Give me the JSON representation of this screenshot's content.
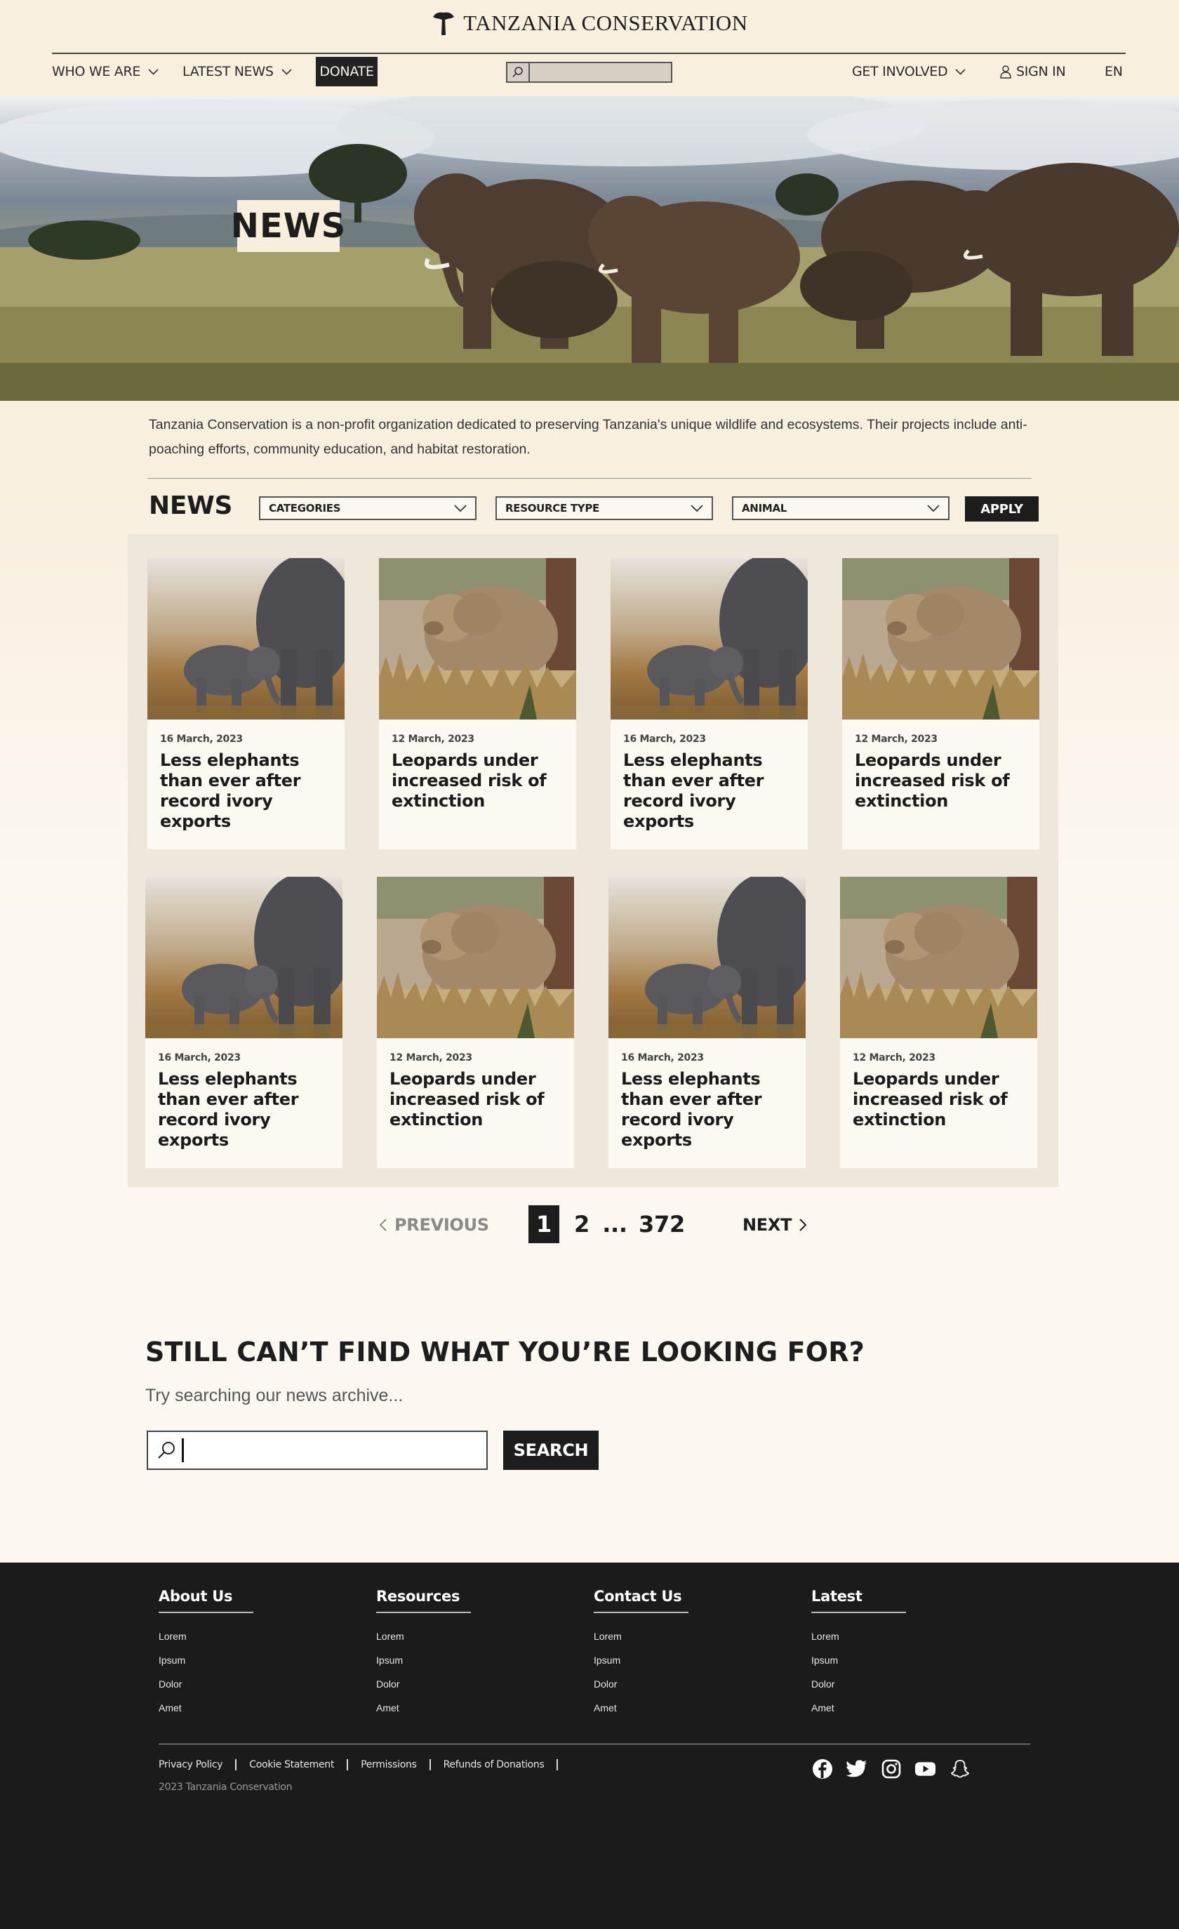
{
  "brand": {
    "name": "TANZANIA CONSERVATION",
    "logo_icon": "acacia-tree-icon"
  },
  "nav": {
    "who_we_are": "WHO WE ARE",
    "latest_news": "LATEST NEWS",
    "donate": "DONATE",
    "search_placeholder": "",
    "get_involved": "GET INVOLVED",
    "sign_in": "SIGN IN",
    "language": "EN"
  },
  "hero": {
    "badge": "NEWS"
  },
  "intro": {
    "text": "Tanzania Conservation is a non-profit organization dedicated to preserving Tanzania's unique wildlife and ecosystems. Their projects include anti-poaching efforts, community education, and habitat restoration."
  },
  "filters": {
    "heading": "NEWS",
    "categories": "CATEGORIES",
    "resource_type": "RESOURCE TYPE",
    "animal": "ANIMAL",
    "apply": "APPLY"
  },
  "cards": [
    {
      "image": "elephant",
      "date": "16 March, 2023",
      "title": "Less elephants than ever after record ivory exports"
    },
    {
      "image": "lioness",
      "date": "12 March, 2023",
      "title": "Leopards under increased risk of extinction"
    },
    {
      "image": "elephant",
      "date": "16 March, 2023",
      "title": "Less elephants than ever after record ivory exports"
    },
    {
      "image": "lioness",
      "date": "12 March, 2023",
      "title": "Leopards under increased risk of extinction"
    },
    {
      "image": "elephant",
      "date": "16 March, 2023",
      "title": "Less elephants than ever after record ivory exports"
    },
    {
      "image": "lioness",
      "date": "12 March, 2023",
      "title": "Leopards under increased risk of extinction"
    },
    {
      "image": "elephant",
      "date": "16 March, 2023",
      "title": "Less elephants than ever after record ivory exports"
    },
    {
      "image": "lioness",
      "date": "12 March, 2023",
      "title": "Leopards under increased risk of extinction"
    }
  ],
  "pagination": {
    "previous": "PREVIOUS",
    "pages": [
      "1",
      "2",
      "...",
      "372"
    ],
    "current": "1",
    "next": "NEXT"
  },
  "archive": {
    "heading": "STILL CAN’T FIND WHAT YOU’RE LOOKING FOR?",
    "subheading": "Try searching our news archive...",
    "input_value": "",
    "button": "SEARCH"
  },
  "footer": {
    "columns": [
      {
        "title": "About Us",
        "items": [
          "Lorem",
          "Ipsum",
          "Dolor",
          "Amet"
        ]
      },
      {
        "title": "Resources",
        "items": [
          "Lorem",
          "Ipsum",
          "Dolor",
          "Amet"
        ]
      },
      {
        "title": "Contact Us",
        "items": [
          "Lorem",
          "Ipsum",
          "Dolor",
          "Amet"
        ]
      },
      {
        "title": "Latest",
        "items": [
          "Lorem",
          "Ipsum",
          "Dolor",
          "Amet"
        ]
      }
    ],
    "links": [
      "Privacy Policy",
      "Cookie Statement",
      "Permissions",
      "Refunds of Donations"
    ],
    "copyright": "2023 Tanzania Conservation",
    "social": [
      "facebook-icon",
      "twitter-icon",
      "instagram-icon",
      "youtube-icon",
      "snapchat-icon"
    ]
  }
}
